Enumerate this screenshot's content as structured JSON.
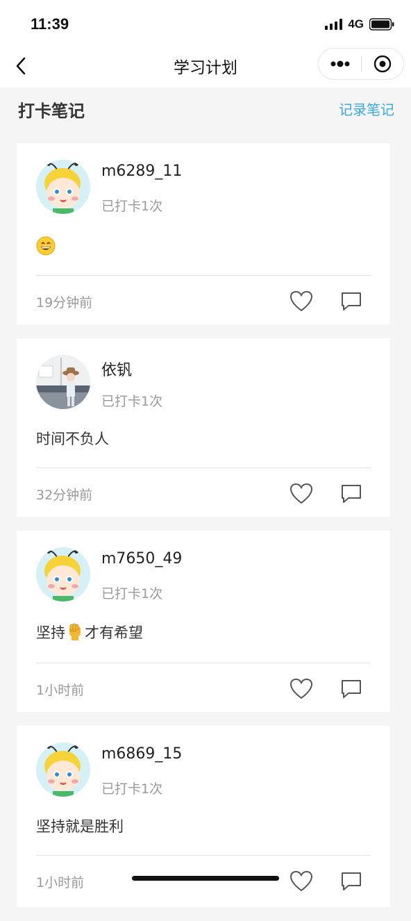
{
  "status_bar": {
    "time": "11:39",
    "network": "4G"
  },
  "nav": {
    "title": "学习计划"
  },
  "section": {
    "title": "打卡笔记",
    "action": "记录笔记"
  },
  "posts": [
    {
      "username": "m6289_11",
      "checkin": "已打卡1次",
      "content_before": "",
      "content_after": "",
      "emoji": "grinning-face",
      "time": "19分钟前",
      "avatar": "bee-avatar"
    },
    {
      "username": "依钒",
      "checkin": "已打卡1次",
      "content_before": "时间不负人",
      "content_after": "",
      "emoji": "",
      "time": "32分钟前",
      "avatar": "photo-avatar"
    },
    {
      "username": "m7650_49",
      "checkin": "已打卡1次",
      "content_before": "坚持",
      "content_after": "才有希望",
      "emoji": "raised-fist",
      "time": "1小时前",
      "avatar": "bee-avatar"
    },
    {
      "username": "m6869_15",
      "checkin": "已打卡1次",
      "content_before": "坚持就是胜利",
      "content_after": "",
      "emoji": "",
      "time": "1小时前",
      "avatar": "bee-avatar"
    }
  ],
  "colors": {
    "accent": "#3aa7e6",
    "background": "#f5f5f5"
  }
}
